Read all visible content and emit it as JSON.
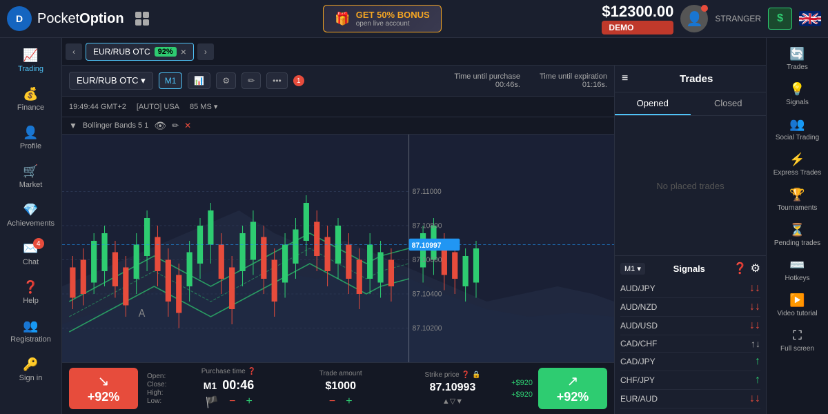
{
  "header": {
    "logo_text1": "Pocket",
    "logo_text2": "Option",
    "bonus_main": "GET 50% BONUS",
    "bonus_sub": "open live account",
    "balance": "$12300.00",
    "demo": "DEMO",
    "user_name": "STRANGER",
    "dollar": "$"
  },
  "tabs": {
    "left_arrow": "‹",
    "right_arrow": "›",
    "tab_label": "EUR/RUB OTC",
    "tab_pct": "92%"
  },
  "chart": {
    "pair": "EUR/RUB OTC ▾",
    "time_m1": "M1",
    "badge_1": "1",
    "time_info": "19:49:44 GMT+2",
    "auto": "[AUTO] USA",
    "ms": "85 MS ▾",
    "indicator": "Bollinger Bands 5 1",
    "time_purchase_label": "Time until purchase",
    "time_purchase": "00:46s.",
    "time_expiry_label": "Time until expiration",
    "time_expiry": "01:16s.",
    "price_main": "87.11000",
    "price_current": "87.10997",
    "price_mid": "87.10800",
    "price_low1": "87.10600",
    "price_low2": "87.10400",
    "price_low3": "87.10200"
  },
  "trading_panel": {
    "sell_pct": "+92%",
    "buy_pct": "+92%",
    "open_label": "Open:",
    "close_label": "Close:",
    "high_label": "High:",
    "low_label": "Low:",
    "purchase_time_label": "Purchase time",
    "purchase_time": "M1",
    "purchase_sub": "00:46",
    "trade_amount_label": "Trade amount",
    "trade_amount": "$1000",
    "strike_price_label": "Strike price",
    "strike_price": "87.10993",
    "profit_up": "+$920",
    "profit_down": "+$920"
  },
  "trades": {
    "title": "Trades",
    "tab_opened": "Opened",
    "tab_closed": "Closed",
    "no_trades": "No placed trades"
  },
  "signals": {
    "timeframe": "M1 ▾",
    "title": "Signals",
    "pairs": [
      {
        "name": "AUD/JPY",
        "direction": "down"
      },
      {
        "name": "AUD/NZD",
        "direction": "down"
      },
      {
        "name": "AUD/USD",
        "direction": "down"
      },
      {
        "name": "CAD/CHF",
        "direction": "both"
      },
      {
        "name": "CAD/JPY",
        "direction": "up"
      },
      {
        "name": "CHF/JPY",
        "direction": "up"
      },
      {
        "name": "EUR/AUD",
        "direction": "down"
      }
    ]
  },
  "left_sidebar": {
    "items": [
      {
        "icon": "📈",
        "label": "Trading"
      },
      {
        "icon": "💰",
        "label": "Finance"
      },
      {
        "icon": "👤",
        "label": "Profile"
      },
      {
        "icon": "🛒",
        "label": "Market"
      },
      {
        "icon": "💎",
        "label": "Achievements"
      },
      {
        "icon": "💬",
        "label": "Chat",
        "badge": "4"
      },
      {
        "icon": "❓",
        "label": "Help"
      },
      {
        "icon": "👥",
        "label": "Registration"
      },
      {
        "icon": "🔑",
        "label": "Sign in"
      }
    ]
  },
  "right_nav": {
    "items": [
      {
        "icon": "🔄",
        "label": "Trades"
      },
      {
        "icon": "💡",
        "label": "Signals"
      },
      {
        "icon": "👥",
        "label": "Social Trading"
      },
      {
        "icon": "⚡",
        "label": "Express Trades"
      },
      {
        "icon": "🏆",
        "label": "Tournaments"
      },
      {
        "icon": "⏳",
        "label": "Pending trades"
      },
      {
        "icon": "⌨️",
        "label": "Hotkeys"
      },
      {
        "icon": "▶️",
        "label": "Video tutorial"
      },
      {
        "icon": "⛶",
        "label": "Full screen"
      }
    ]
  }
}
